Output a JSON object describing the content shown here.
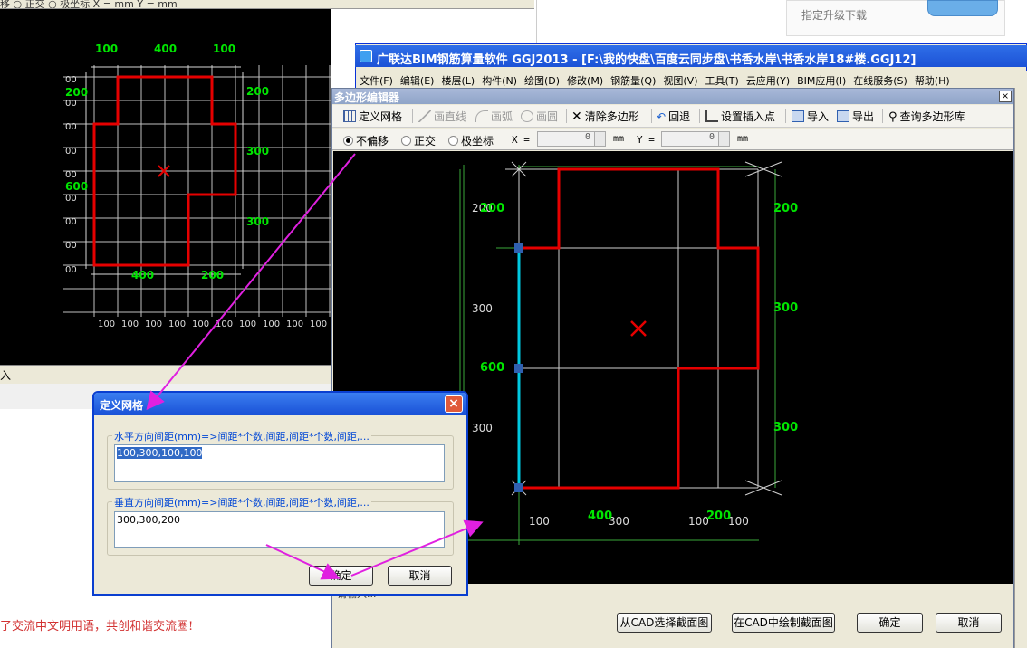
{
  "bg_app": {
    "top_fragment": "移 ○ 正交 ○ 极坐标 X =  mm  Y = mm",
    "status_char": "入"
  },
  "forum_text": "了交流中文明用语，共创和谐交流圈!",
  "ad": {
    "upgrade_text": "指定升级下载"
  },
  "left_drawing": {
    "top_dims": [
      "100",
      "400",
      "100"
    ],
    "bottom_dims": [
      "400",
      "200"
    ],
    "left_dims": [
      "200",
      "600"
    ],
    "left_small": [
      "00",
      "00",
      "00",
      "00",
      "00",
      "00",
      "00",
      "00",
      "00"
    ],
    "right_dims": [
      "200",
      "300",
      "300"
    ],
    "grid_labels": [
      "100",
      "100",
      "100",
      "100",
      "100",
      "100",
      "100",
      "100",
      "100",
      "100"
    ]
  },
  "main_window": {
    "title": "广联达BIM钢筋算量软件 GGJ2013 - [F:\\我的快盘\\百度云同步盘\\书香水岸\\书香水岸18#楼.GGJ12]",
    "menu": [
      "文件(F)",
      "编辑(E)",
      "楼层(L)",
      "构件(N)",
      "绘图(D)",
      "修改(M)",
      "钢筋量(Q)",
      "视图(V)",
      "工具(T)",
      "云应用(Y)",
      "BIM应用(I)",
      "在线服务(S)",
      "帮助(H)"
    ]
  },
  "poly_editor": {
    "title": "多边形编辑器",
    "close_label": "×",
    "toolbar": {
      "define_grid": "定义网格",
      "draw_line": "画直线",
      "draw_arc": "画弧",
      "draw_circle": "画圆",
      "clear_polygon": "清除多边形",
      "undo": "回退",
      "set_insert_point": "设置插入点",
      "import": "导入",
      "export": "导出",
      "query_library": "查询多边形库"
    },
    "options": {
      "no_offset": "不偏移",
      "orthogonal": "正交",
      "polar": "极坐标",
      "x_label": "X =",
      "x_value": "0",
      "x_unit": "mm",
      "y_label": "Y =",
      "y_value": "0",
      "y_unit": "mm"
    },
    "drawing": {
      "left_green": [
        "200",
        "600"
      ],
      "left_white": [
        "200",
        "300",
        "300"
      ],
      "right_green": [
        "200",
        "300",
        "300"
      ],
      "bottom_white": [
        "100",
        "300",
        "100",
        "100"
      ],
      "bottom_green": [
        "400",
        "200"
      ]
    },
    "status_text": "请输入...",
    "buttons": {
      "from_cad": "从CAD选择截面图",
      "draw_in_cad": "在CAD中绘制截面图",
      "ok": "确定",
      "cancel": "取消"
    }
  },
  "grid_dialog": {
    "title": "定义网格",
    "close_label": "×",
    "horizontal_label": "水平方向间距(mm)=>间距*个数,间距,间距*个数,间距,...",
    "horizontal_value": "100,300,100,100",
    "vertical_label": "垂直方向间距(mm)=>间距*个数,间距,间距*个数,间距,...",
    "vertical_value": "300,300,200",
    "ok": "确定",
    "cancel": "取消"
  },
  "colors": {
    "polygon": "#e60000",
    "dim_green": "#00e600",
    "grid": "#bfbfbf",
    "selected_edge": "#00c8e0",
    "arrow": "#e020e0",
    "title_blue": "#1c52d6"
  }
}
